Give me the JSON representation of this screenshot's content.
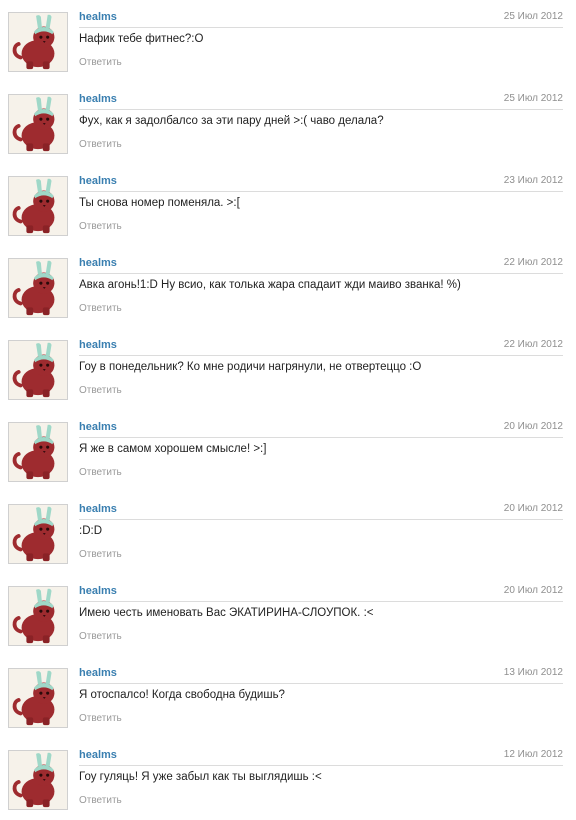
{
  "reply_label": "Ответить",
  "colors": {
    "author_link": "#3a7fb0",
    "date_text": "#8f8f8f",
    "reply_link": "#9a9a9a",
    "avatar_cat": "#9e2b2f",
    "avatar_ears": "#9fd8c8"
  },
  "comments": [
    {
      "author": "healms",
      "date": "25 Июл 2012",
      "text": "Нафик тебе фитнес?:О",
      "avatar_icon": "red-cat-bunny-ears-avatar"
    },
    {
      "author": "healms",
      "date": "25 Июл 2012",
      "text": "Фух, как я задолбалсо за эти пару дней >:( чаво делала?",
      "avatar_icon": "red-cat-bunny-ears-avatar"
    },
    {
      "author": "healms",
      "date": "23 Июл 2012",
      "text": "Ты снова номер поменяла. >:[",
      "avatar_icon": "red-cat-bunny-ears-avatar"
    },
    {
      "author": "healms",
      "date": "22 Июл 2012",
      "text": "Авка агонь!1:D Ну всио, как толька жара спадаит жди маиво званка! %)",
      "avatar_icon": "red-cat-bunny-ears-avatar"
    },
    {
      "author": "healms",
      "date": "22 Июл 2012",
      "text": "Гоу в понедельник? Ко мне родичи нагрянули, не отвертеццо :О",
      "avatar_icon": "red-cat-bunny-ears-avatar"
    },
    {
      "author": "healms",
      "date": "20 Июл 2012",
      "text": "Я же в самом хорошем смысле! >:]",
      "avatar_icon": "red-cat-bunny-ears-avatar"
    },
    {
      "author": "healms",
      "date": "20 Июл 2012",
      "text": ":D:D",
      "avatar_icon": "red-cat-bunny-ears-avatar"
    },
    {
      "author": "healms",
      "date": "20 Июл 2012",
      "text": "Имею честь именовать Вас ЭКАТИРИНА-СЛОУПОК. :<",
      "avatar_icon": "red-cat-bunny-ears-avatar"
    },
    {
      "author": "healms",
      "date": "13 Июл 2012",
      "text": "Я отоспалсо! Когда свободна будишь?",
      "avatar_icon": "red-cat-bunny-ears-avatar"
    },
    {
      "author": "healms",
      "date": "12 Июл 2012",
      "text": "Гоу гуляць! Я уже забыл как ты выглядишь :<",
      "avatar_icon": "red-cat-bunny-ears-avatar"
    }
  ]
}
